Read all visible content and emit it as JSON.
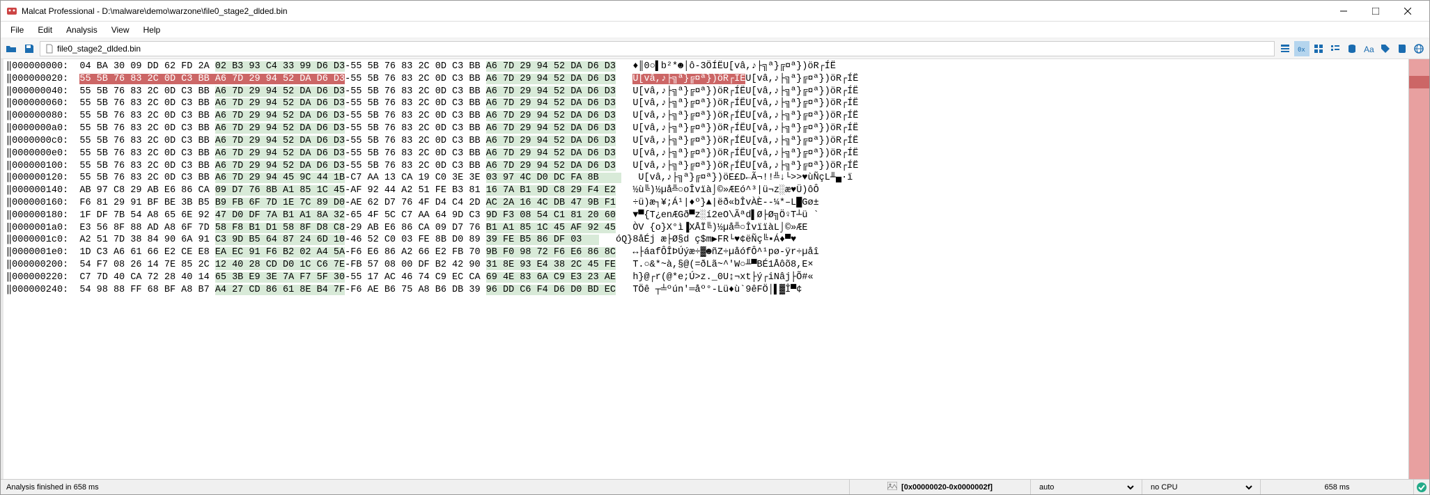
{
  "titlebar": {
    "title": "Malcat Professional - D:\\malware\\demo\\warzone\\file0_stage2_dlded.bin"
  },
  "menubar": {
    "items": [
      "File",
      "Edit",
      "Analysis",
      "View",
      "Help"
    ]
  },
  "toolbar": {
    "path": "file0_stage2_dlded.bin"
  },
  "hex": {
    "lines": [
      {
        "addr": "‖000000000:",
        "bytes": "04 BA 30 09 DD 62 FD 2A 02 B3 93 C4 33 99 D6 D3-55 5B 76 83 2C 0D C3 BB A6 7D 29 94 52 DA D6 D3",
        "ascii": "♦║0○▌b²*☻│ô-3ÖÍËU[vâ,♪├╗ª}╔¤ª})öR┌ÍË",
        "sel": false
      },
      {
        "addr": "‖000000020:",
        "bytes": "55 5B 76 83 2C 0D C3 BB A6 7D 29 94 52 DA D6 D3-55 5B 76 83 2C 0D C3 BB A6 7D 29 94 52 DA D6 D3",
        "ascii": "U[vâ,♪├╗ª}╔¤ª})öR┌ÍËU[vâ,♪├╗ª}╔¤ª})öR┌ÍË",
        "sel": true
      },
      {
        "addr": "‖000000040:",
        "bytes": "55 5B 76 83 2C 0D C3 BB A6 7D 29 94 52 DA D6 D3-55 5B 76 83 2C 0D C3 BB A6 7D 29 94 52 DA D6 D3",
        "ascii": "U[vâ,♪├╗ª}╔¤ª})öR┌ÍËU[vâ,♪├╗ª}╔¤ª})öR┌ÍË",
        "sel": false
      },
      {
        "addr": "‖000000060:",
        "bytes": "55 5B 76 83 2C 0D C3 BB A6 7D 29 94 52 DA D6 D3-55 5B 76 83 2C 0D C3 BB A6 7D 29 94 52 DA D6 D3",
        "ascii": "U[vâ,♪├╗ª}╔¤ª})öR┌ÍËU[vâ,♪├╗ª}╔¤ª})öR┌ÍË",
        "sel": false
      },
      {
        "addr": "‖000000080:",
        "bytes": "55 5B 76 83 2C 0D C3 BB A6 7D 29 94 52 DA D6 D3-55 5B 76 83 2C 0D C3 BB A6 7D 29 94 52 DA D6 D3",
        "ascii": "U[vâ,♪├╗ª}╔¤ª})öR┌ÍËU[vâ,♪├╗ª}╔¤ª})öR┌ÍË",
        "sel": false
      },
      {
        "addr": "‖0000000a0:",
        "bytes": "55 5B 76 83 2C 0D C3 BB A6 7D 29 94 52 DA D6 D3-55 5B 76 83 2C 0D C3 BB A6 7D 29 94 52 DA D6 D3",
        "ascii": "U[vâ,♪├╗ª}╔¤ª})öR┌ÍËU[vâ,♪├╗ª}╔¤ª})öR┌ÍË",
        "sel": false
      },
      {
        "addr": "‖0000000c0:",
        "bytes": "55 5B 76 83 2C 0D C3 BB A6 7D 29 94 52 DA D6 D3-55 5B 76 83 2C 0D C3 BB A6 7D 29 94 52 DA D6 D3",
        "ascii": "U[vâ,♪├╗ª}╔¤ª})öR┌ÍËU[vâ,♪├╗ª}╔¤ª})öR┌ÍË",
        "sel": false
      },
      {
        "addr": "‖0000000e0:",
        "bytes": "55 5B 76 83 2C 0D C3 BB A6 7D 29 94 52 DA D6 D3-55 5B 76 83 2C 0D C3 BB A6 7D 29 94 52 DA D6 D3",
        "ascii": "U[vâ,♪├╗ª}╔¤ª})öR┌ÍËU[vâ,♪├╗ª}╔¤ª})öR┌ÍË",
        "sel": false
      },
      {
        "addr": "‖000000100:",
        "bytes": "55 5B 76 83 2C 0D C3 BB A6 7D 29 94 52 DA D6 D3-55 5B 76 83 2C 0D C3 BB A6 7D 29 94 52 DA D6 D3",
        "ascii": "U[vâ,♪├╗ª}╔¤ª})öR┌ÍËU[vâ,♪├╗ª}╔¤ª})öR┌ÍË",
        "sel": false
      },
      {
        "addr": "‖000000120:",
        "bytes": "55 5B 76 83 2C 0D C3 BB A6 7D 29 94 45 9C 44 1B-C7 AA 13 CA 19 C0 3E 3E 03 97 4C D0 DC FA 8B    ",
        "ascii": "U[vâ,♪├╗ª}╔¤ª})öE£D←Ã¬!!╩↓└>>♥ùÑçL╨▄·ï",
        "sel": false
      },
      {
        "addr": "‖000000140:",
        "bytes": "AB 97 C8 29 AB E6 86 CA 09 D7 76 8B A1 85 1C 45-AF 92 44 A2 51 FE B3 81 16 7A B1 9D C8 29 F4 E2",
        "ascii": "½ù╚)½µå╩○oÎvïà⌡©»ÆEó^³|ü¬z░æ♥Ü)ôÔ",
        "sel": false
      },
      {
        "addr": "‖000000160:",
        "bytes": "F6 81 29 91 BF BE 3B B5 B9 FB 6F 7D 1E 7C 89 D0-AE 62 D7 76 4F D4 C4 2D AC 2A 16 4C DB 47 9B F1",
        "ascii": "÷ü)æ┐¥;Á¹|♦º}▲|ëð«bÎvÀÈ--¼*–L█Gø±",
        "sel": false
      },
      {
        "addr": "‖000000180:",
        "bytes": "1F DF 7B 54 A8 65 6E 92 47 D0 DF 7A B1 A1 8A 32-65 4F 5C C7 AA 64 9D C3 9D F3 08 54 C1 81 20 60",
        "ascii": "▼▀{T¿enÆGð▀z░í2eO\\Ãªd▌Ø├Ø╗Ö♀T┴ü `",
        "sel": false
      },
      {
        "addr": "‖0000001a0:",
        "bytes": "E3 56 8F 88 AD A8 6F 7D 58 F8 B1 D1 58 8F D8 C8-29 AB E6 86 CA 09 D7 76 B1 A1 85 1C 45 AF 92 45",
        "ascii": "ÒV {o}X°ì▐XÅÏ╚)½µå╩○ÎvïïàL⌡©»ÆE",
        "sel": false
      },
      {
        "addr": "‖0000001c0:",
        "bytes": "A2 51 7D 38 84 90 6A 91 C3 9D B5 64 87 24 6D 10-46 52 C0 03 FE 8B D0 89 39 FE B5 86 DF 03   ",
        "ascii": "óQ}8åÉj æ├Ø§d ç$m▶FR└♥¢ëÑç╚▪Á♦▀♥",
        "sel": false
      },
      {
        "addr": "‖0000001e0:",
        "bytes": "1D C3 A6 61 66 E2 CE E8 EA EC 91 F6 B2 02 A4 5A-F6 E6 86 A2 66 E2 FB 70 9B F0 98 72 F6 E6 86 8C",
        "ascii": "↔├áafÔÎÞÚýæ÷▓☻ñZ÷µåófÔ^¹pø-ÿr÷µåî",
        "sel": false
      },
      {
        "addr": "‖000000200:",
        "bytes": "54 F7 08 26 14 7E 85 2C 12 40 28 CD D0 1C C6 7E-FB 57 08 00 DF B2 42 90 31 8E 93 E4 38 2C 45 FE",
        "ascii": "T.○&*~à,§@(=ðLã~^'W○╨▀BÉ1Åôõ8,E×",
        "sel": false
      },
      {
        "addr": "‖000000220:",
        "bytes": "C7 7D 40 CA 72 28 40 14 65 3B E9 3E 7A F7 5F 30-55 17 AC 46 74 C9 EC CA 69 4E 83 6A C9 E3 23 AE",
        "ascii": "h}@┌r(@*e;Ú>z._0U↨¬xt├ý┌iNâj├Õ#«",
        "sel": false
      },
      {
        "addr": "‖000000240:",
        "bytes": "54 98 88 FF 68 BF A8 B7 A4 27 CD 86 61 8E B4 7F-F6 AE B6 75 A8 B6 DB 39 96 DD C6 F4 D6 D0 BD EC",
        "ascii": "TÖê ┬╧ºún'═åº°-Lü♦ù`9êFÖ│▌▓Î▀¢",
        "sel": false
      }
    ]
  },
  "statusbar": {
    "left": "Analysis finished in 658 ms",
    "center": "[0x00000020-0x0000002f]",
    "select1": "auto",
    "select2": "no CPU",
    "right": "658 ms"
  }
}
